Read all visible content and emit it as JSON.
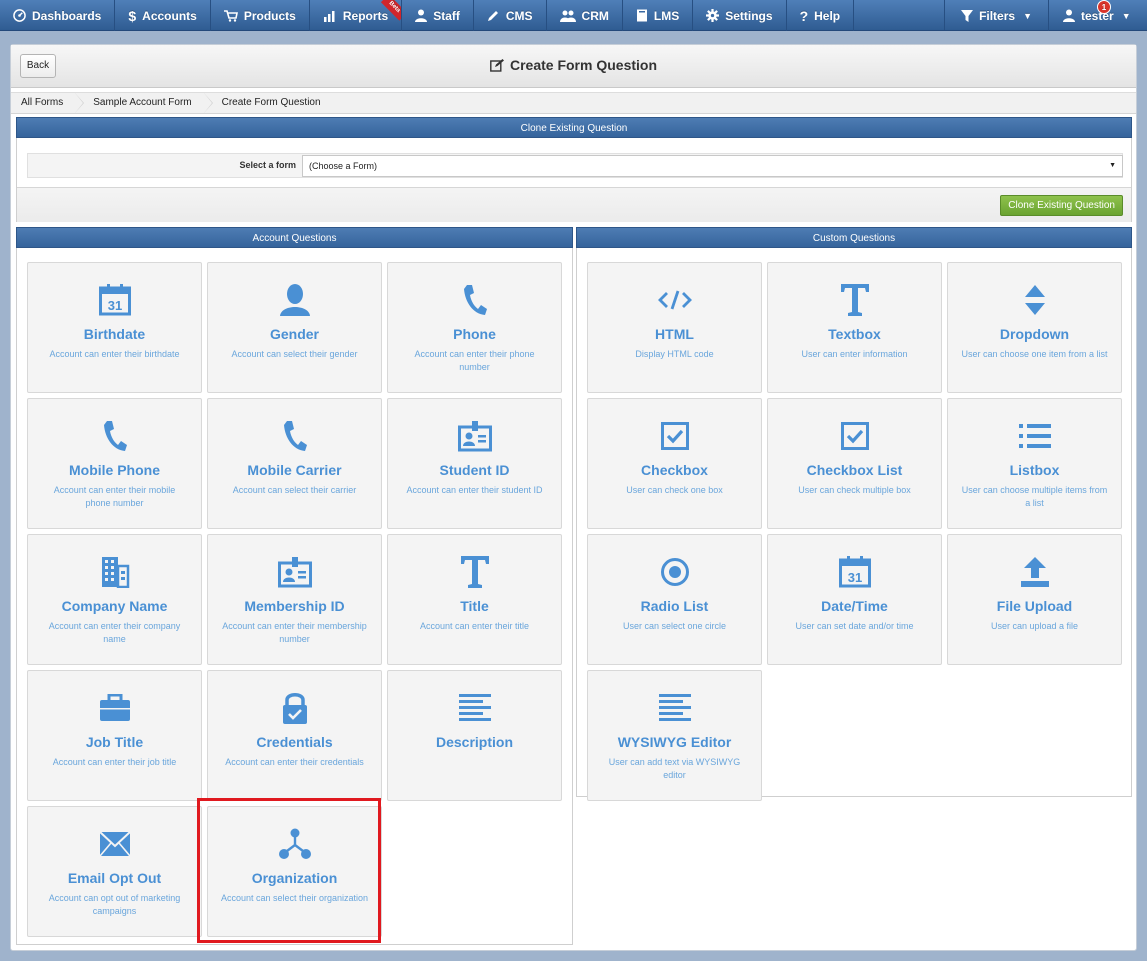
{
  "nav": {
    "items": [
      {
        "name": "nav-dashboards",
        "icon": "dashboard-icon",
        "label": "Dashboards"
      },
      {
        "name": "nav-accounts",
        "icon": "dollar-icon",
        "label": "Accounts"
      },
      {
        "name": "nav-products",
        "icon": "cart-icon",
        "label": "Products"
      },
      {
        "name": "nav-reports",
        "icon": "bar-chart-icon",
        "label": "Reports",
        "badge": "Beta"
      },
      {
        "name": "nav-staff",
        "icon": "user-icon",
        "label": "Staff"
      },
      {
        "name": "nav-cms",
        "icon": "pencil-icon",
        "label": "CMS"
      },
      {
        "name": "nav-crm",
        "icon": "users-icon",
        "label": "CRM"
      },
      {
        "name": "nav-lms",
        "icon": "book-icon",
        "label": "LMS"
      },
      {
        "name": "nav-settings",
        "icon": "gear-icon",
        "label": "Settings"
      },
      {
        "name": "nav-help",
        "icon": "question-icon",
        "label": "Help"
      }
    ],
    "filters": "Filters",
    "user": "tester",
    "notification_count": "1"
  },
  "header": {
    "back": "Back",
    "title": "Create Form Question"
  },
  "breadcrumb": [
    "All Forms",
    "Sample Account Form",
    "Create Form Question"
  ],
  "clone": {
    "heading": "Clone Existing Question",
    "select_label": "Select a form",
    "select_value": "(Choose a Form)",
    "button": "Clone Existing Question"
  },
  "account_questions": {
    "heading": "Account Questions",
    "cards": [
      {
        "icon": "calendar-icon",
        "label": "Birthdate",
        "desc": "Account can enter their birthdate"
      },
      {
        "icon": "person-icon",
        "label": "Gender",
        "desc": "Account can select their gender"
      },
      {
        "icon": "phone-icon",
        "label": "Phone",
        "desc": "Account can enter their phone number"
      },
      {
        "icon": "phone-icon",
        "label": "Mobile Phone",
        "desc": "Account can enter their mobile phone number"
      },
      {
        "icon": "phone-icon",
        "label": "Mobile Carrier",
        "desc": "Account can select their carrier"
      },
      {
        "icon": "id-card-icon",
        "label": "Student ID",
        "desc": "Account can enter their student ID"
      },
      {
        "icon": "building-icon",
        "label": "Company Name",
        "desc": "Account can enter their company name"
      },
      {
        "icon": "id-card-icon",
        "label": "Membership ID",
        "desc": "Account can enter their membership number"
      },
      {
        "icon": "text-t-icon",
        "label": "Title",
        "desc": "Account can enter their title"
      },
      {
        "icon": "briefcase-icon",
        "label": "Job Title",
        "desc": "Account can enter their job title"
      },
      {
        "icon": "lock-check-icon",
        "label": "Credentials",
        "desc": "Account can enter their credentials"
      },
      {
        "icon": "align-left-icon",
        "label": "Description",
        "desc": ""
      },
      {
        "icon": "envelope-icon",
        "label": "Email Opt Out",
        "desc": "Account can opt out of marketing campaigns"
      },
      {
        "icon": "network-icon",
        "label": "Organization",
        "desc": "Account can select their organization"
      }
    ]
  },
  "custom_questions": {
    "heading": "Custom Questions",
    "cards": [
      {
        "icon": "code-icon",
        "label": "HTML",
        "desc": "Display HTML code"
      },
      {
        "icon": "text-t-icon",
        "label": "Textbox",
        "desc": "User can enter information"
      },
      {
        "icon": "sort-icon",
        "label": "Dropdown",
        "desc": "User can choose one item from a list"
      },
      {
        "icon": "checkbox-icon",
        "label": "Checkbox",
        "desc": "User can check one box"
      },
      {
        "icon": "checkbox-icon",
        "label": "Checkbox List",
        "desc": "User can check multiple box"
      },
      {
        "icon": "list-icon",
        "label": "Listbox",
        "desc": "User can choose multiple items from a list"
      },
      {
        "icon": "radio-icon",
        "label": "Radio List",
        "desc": "User can select one circle"
      },
      {
        "icon": "calendar-icon",
        "label": "Date/Time",
        "desc": "User can set date and/or time"
      },
      {
        "icon": "upload-icon",
        "label": "File Upload",
        "desc": "User can upload a file"
      },
      {
        "icon": "align-left-icon",
        "label": "WYSIWYG Editor",
        "desc": "User can add text via WYSIWYG editor"
      }
    ]
  }
}
